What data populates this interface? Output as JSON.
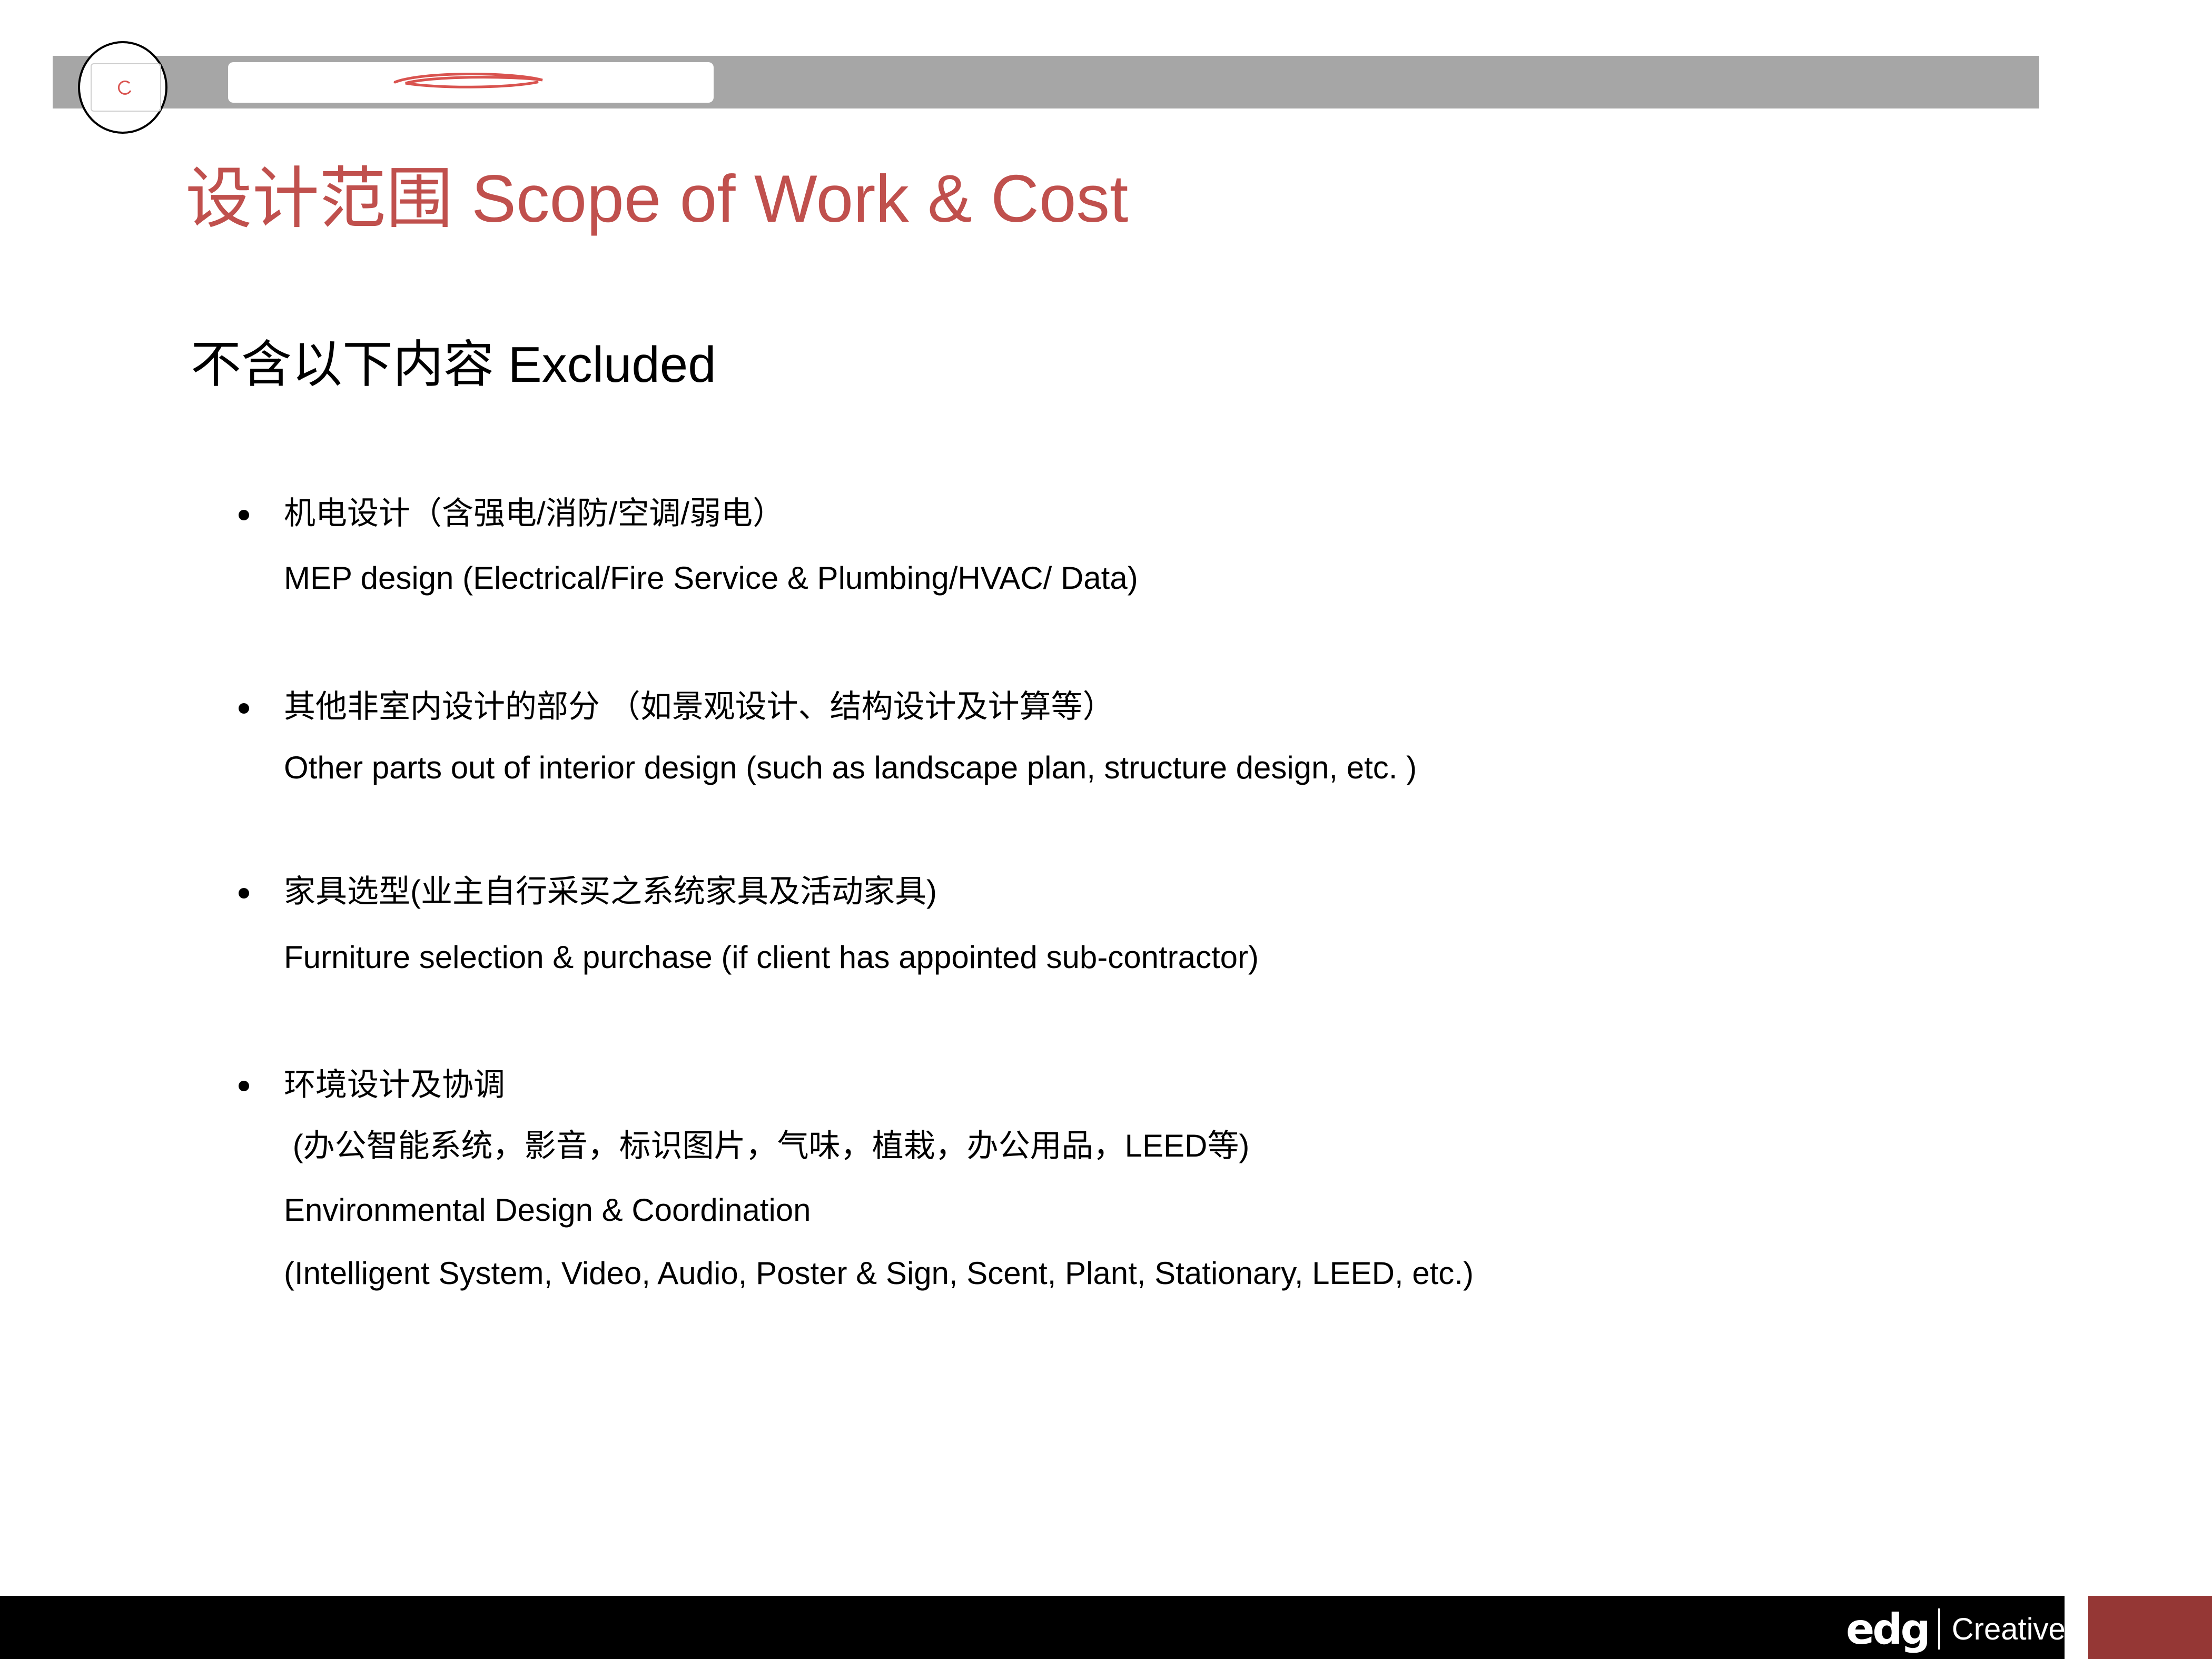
{
  "header": {
    "title": "设计范围 Scope of Work & Cost",
    "section_heading": "不含以下内容  Excluded"
  },
  "excluded_items": [
    {
      "lines": [
        "机电设计（含强电/消防/空调/弱电）",
        "MEP design (Electrical/Fire Service & Plumbing/HVAC/ Data)"
      ]
    },
    {
      "lines": [
        "其他非室内设计的部分 （如景观设计、结构设计及计算等）",
        "Other parts out of interior design (such as landscape plan, structure design, etc. )"
      ]
    },
    {
      "lines": [
        "家具选型(业主自行采买之系统家具及活动家具)",
        "Furniture selection & purchase (if client has appointed sub-contractor)"
      ]
    },
    {
      "lines": [
        "环境设计及协调",
        " (办公智能系统，影音，标识图片，气味，植栽，办公用品，LEED等)",
        "Environmental Design & Coordination",
        "(Intelligent System, Video, Audio, Poster & Sign, Scent, Plant, Stationary, LEED, etc.)"
      ]
    }
  ],
  "footer": {
    "logo_mark": "edg",
    "logo_name": "Creatives"
  },
  "colors": {
    "title": "#c0504d",
    "header_bar": "#a6a6a6",
    "footer_bar": "#000000",
    "footer_accent": "#953735"
  }
}
